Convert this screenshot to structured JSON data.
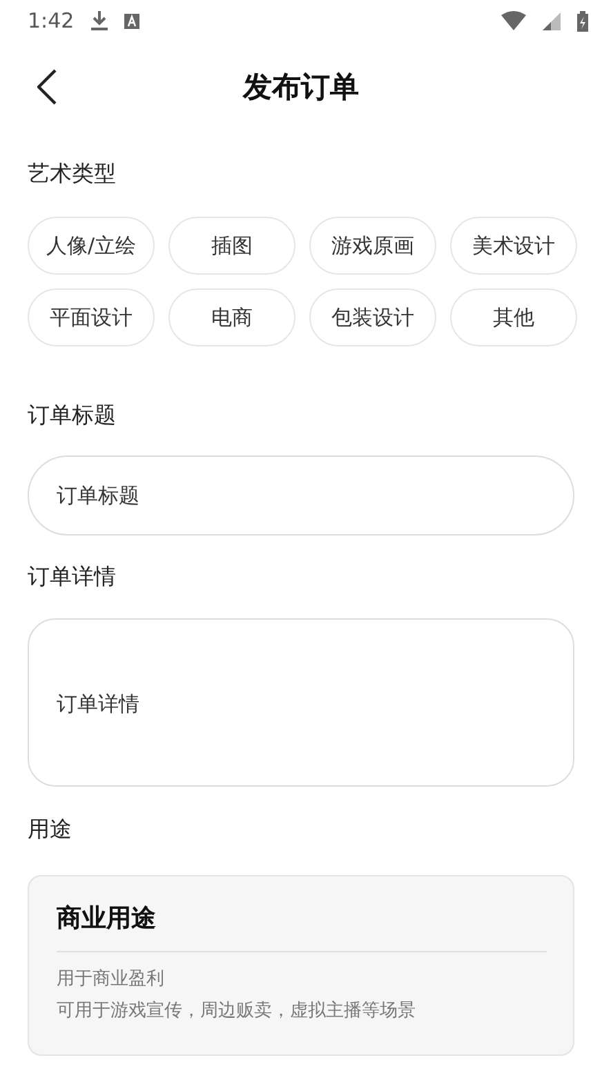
{
  "status_bar": {
    "time": "1:42"
  },
  "header": {
    "title": "发布订单"
  },
  "art_type": {
    "label": "艺术类型",
    "options": [
      {
        "label": "人像/立绘",
        "selected": false
      },
      {
        "label": "插图",
        "selected": false
      },
      {
        "label": "游戏原画",
        "selected": false
      },
      {
        "label": "美术设计",
        "selected": false
      },
      {
        "label": "平面设计",
        "selected": false
      },
      {
        "label": "电商",
        "selected": false
      },
      {
        "label": "包装设计",
        "selected": false
      },
      {
        "label": "其他",
        "selected": false
      }
    ]
  },
  "order_title": {
    "label": "订单标题",
    "placeholder": "订单标题"
  },
  "order_details": {
    "label": "订单详情",
    "placeholder": "订单详情"
  },
  "usage": {
    "label": "用途",
    "card": {
      "title": "商业用途",
      "lines": [
        "用于商业盈利",
        "可用于游戏宣传，周边贩卖，虚拟主播等场景"
      ]
    }
  }
}
